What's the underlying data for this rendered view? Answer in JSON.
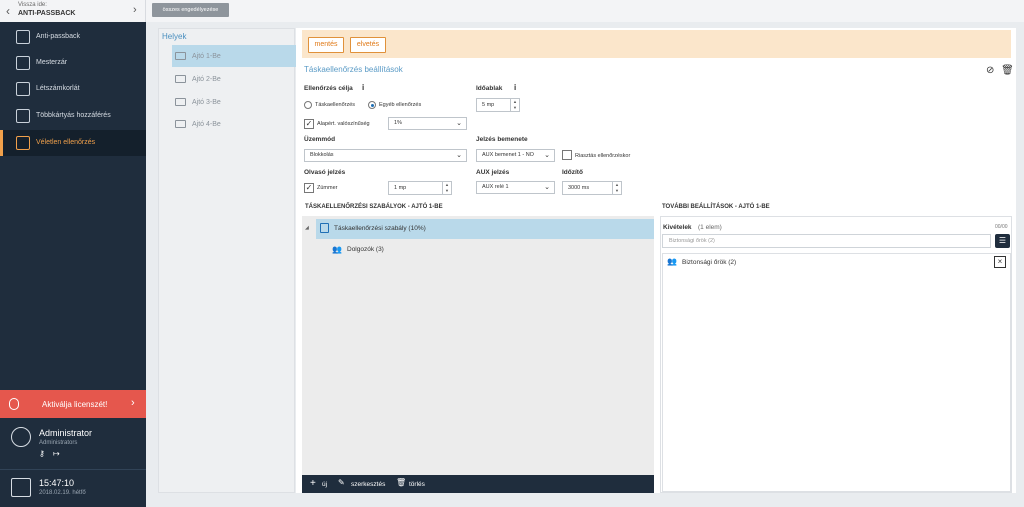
{
  "top": {
    "back_sub": "Vissza ide:",
    "back_main": "ANTI-PASSBACK",
    "allow_all": "összes engedélyezése"
  },
  "sidebar": {
    "items": [
      {
        "label": "Anti-passback",
        "icon": "anti-passback-icon"
      },
      {
        "label": "Mesterzár",
        "icon": "lock-icon"
      },
      {
        "label": "Létszámkorlát",
        "icon": "people-limit-icon"
      },
      {
        "label": "Többkártyás hozzáférés",
        "icon": "multi-card-icon"
      },
      {
        "label": "Véletlen ellenőrzés",
        "icon": "random-check-icon"
      }
    ],
    "license": "Aktiválja licenszét!",
    "user_name": "Administrator",
    "user_role": "Administrators",
    "time": "15:47:10",
    "date": "2018.02.19. hétfő"
  },
  "places": {
    "title": "Helyek",
    "items": [
      "Ajtó 1-Be",
      "Ajtó 2-Be",
      "Ajtó 3-Be",
      "Ajtó 4-Be"
    ]
  },
  "main": {
    "save": "mentés",
    "discard": "elvetés",
    "settings_title": "Táskaellenőrzés beállítások",
    "purpose_label": "Ellenőrzés célja",
    "purpose_opt1": "Táskaellenőrzés",
    "purpose_opt2": "Egyéb ellenőrzés",
    "window_label": "Időablak",
    "window_value": "5 mp",
    "default_prob_label": "Alapért. valószínűség",
    "default_prob_value": "1%",
    "mode_label": "Üzemmód",
    "mode_value": "Blokkolás",
    "signal_input_label": "Jelzés bemenete",
    "signal_input_value": "AUX bemenet 1 - NO",
    "alarm_label": "Riasztás ellenőrzéskor",
    "reader_signal_label": "Olvasó jelzés",
    "buzzer_label": "Zümmer",
    "buzzer_value": "1 mp",
    "aux_signal_label": "AUX jelzés",
    "aux_signal_value": "AUX relé 1",
    "timer_label": "Időzítő",
    "timer_value": "3000 ms",
    "rules_title": "TÁSKAELLENŐRZÉSI SZABÁLYOK - AJTÓ 1-BE",
    "rule_row": "Táskaellenőrzési szabály (10%)",
    "group_row": "Dolgozók (3)",
    "btn_new": "új",
    "btn_edit": "szerkesztés",
    "btn_delete": "törlés",
    "more_title": "TOVÁBBI BEÁLLÍTÁSOK - AJTÓ 1-BE",
    "exceptions_label": "Kivételek",
    "exceptions_count": "(1 elem)",
    "counter": "00/00",
    "exception_search_placeholder": "Biztonsági őrök (2)",
    "exception_item": "Biztonsági őrök (2)"
  }
}
